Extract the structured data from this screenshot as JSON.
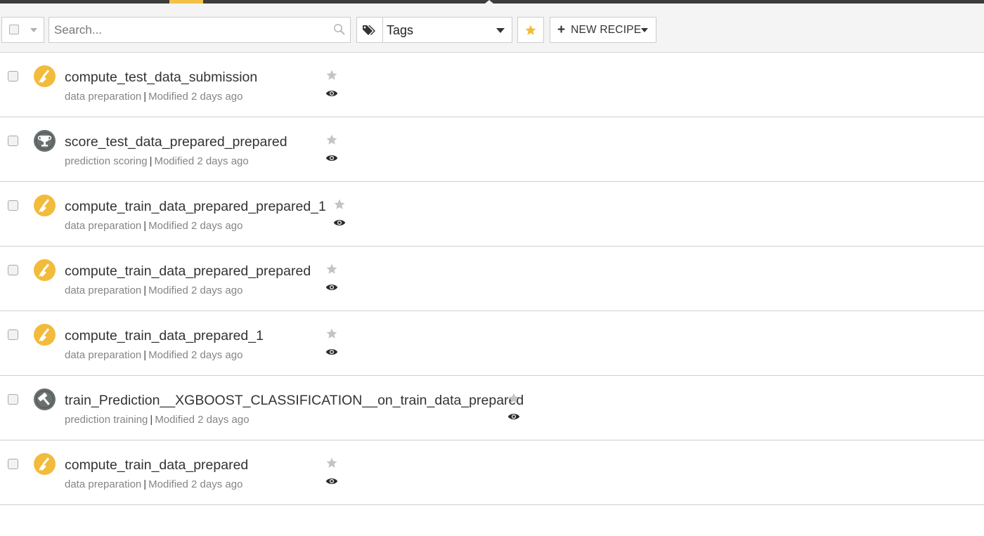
{
  "toolbar": {
    "search_placeholder": "Search...",
    "tags_label": "Tags",
    "new_recipe_label": "NEW RECIPE",
    "accent_color": "#f2bb3c"
  },
  "recipes": [
    {
      "name": "compute_test_data_submission",
      "type": "data preparation",
      "modified": "Modified 2 days ago",
      "icon": "broom-icon"
    },
    {
      "name": "score_test_data_prepared_prepared",
      "type": "prediction scoring",
      "modified": "Modified 2 days ago",
      "icon": "trophy-icon"
    },
    {
      "name": "compute_train_data_prepared_prepared_1",
      "type": "data preparation",
      "modified": "Modified 2 days ago",
      "icon": "broom-icon"
    },
    {
      "name": "compute_train_data_prepared_prepared",
      "type": "data preparation",
      "modified": "Modified 2 days ago",
      "icon": "broom-icon"
    },
    {
      "name": "compute_train_data_prepared_1",
      "type": "data preparation",
      "modified": "Modified 2 days ago",
      "icon": "broom-icon"
    },
    {
      "name": "train_Prediction__XGBOOST_CLASSIFICATION__on_train_data_prepared",
      "type": "prediction training",
      "modified": "Modified 2 days ago",
      "icon": "hammer-icon"
    },
    {
      "name": "compute_train_data_prepared",
      "type": "data preparation",
      "modified": "Modified 2 days ago",
      "icon": "broom-icon"
    }
  ]
}
